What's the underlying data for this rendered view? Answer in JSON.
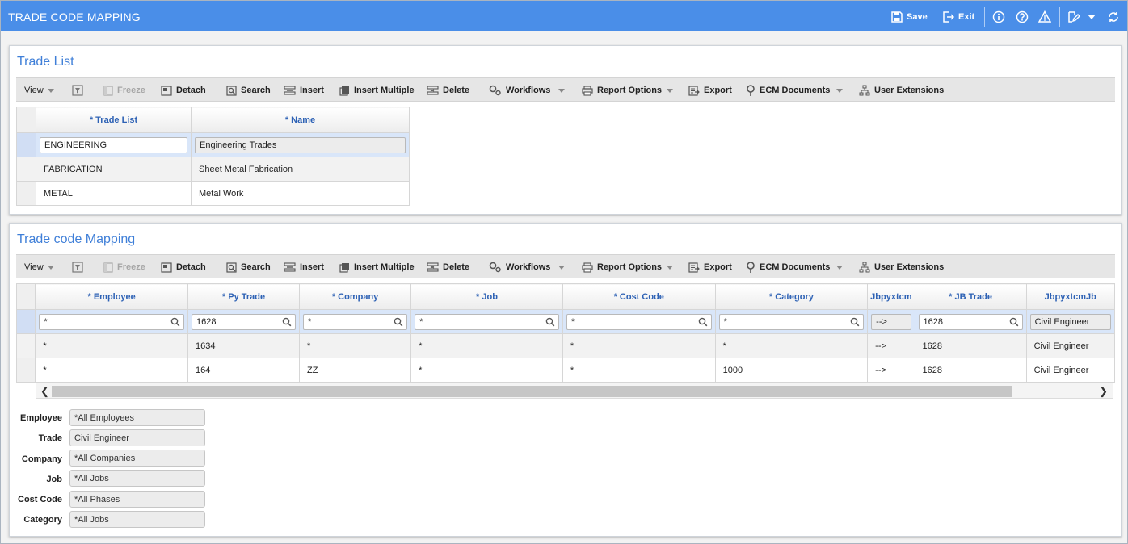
{
  "app": {
    "title": "TRADE CODE MAPPING",
    "save_label": "Save",
    "exit_label": "Exit"
  },
  "toolbar": {
    "view": "View",
    "freeze": "Freeze",
    "detach": "Detach",
    "search": "Search",
    "insert": "Insert",
    "insert_multiple": "Insert Multiple",
    "delete": "Delete",
    "workflows": "Workflows",
    "report_options": "Report Options",
    "export": "Export",
    "ecm_documents": "ECM Documents",
    "user_extensions": "User Extensions"
  },
  "trade_list": {
    "title": "Trade List",
    "columns": [
      "* Trade List",
      "* Name"
    ],
    "rows": [
      {
        "code": "ENGINEERING",
        "name": "Engineering Trades"
      },
      {
        "code": "FABRICATION",
        "name": "Sheet Metal Fabrication"
      },
      {
        "code": "METAL",
        "name": "Metal Work"
      }
    ]
  },
  "mapping": {
    "title": "Trade code Mapping",
    "columns": [
      "* Employee",
      "* Py Trade",
      "* Company",
      "* Job",
      "* Cost Code",
      "* Category",
      "Jbpyxtcm",
      "* JB Trade",
      "JbpyxtcmJb"
    ],
    "rows": [
      {
        "employee": "*",
        "py_trade": "1628",
        "company": "*",
        "job": "*",
        "cost_code": "*",
        "category": "*",
        "arrow": "-->",
        "jb_trade": "1628",
        "jb_name": "Civil Engineer"
      },
      {
        "employee": "*",
        "py_trade": "1634",
        "company": "*",
        "job": "*",
        "cost_code": "*",
        "category": "*",
        "arrow": "-->",
        "jb_trade": "1628",
        "jb_name": "Civil Engineer"
      },
      {
        "employee": "*",
        "py_trade": "164",
        "company": "ZZ",
        "job": "*",
        "cost_code": "*",
        "category": "1000",
        "arrow": "-->",
        "jb_trade": "1628",
        "jb_name": "Civil Engineer"
      }
    ]
  },
  "detail": {
    "fields": [
      {
        "label": "Employee",
        "value": "*All Employees"
      },
      {
        "label": "Trade",
        "value": "Civil Engineer"
      },
      {
        "label": "Company",
        "value": "*All Companies"
      },
      {
        "label": "Job",
        "value": "*All Jobs"
      },
      {
        "label": "Cost Code",
        "value": "*All Phases"
      },
      {
        "label": "Category",
        "value": "*All Jobs"
      }
    ]
  },
  "colors": {
    "titlebar": "#4a8ee8",
    "panel_title": "#3f7fd8",
    "column_header": "#2e62b5",
    "selected_row": "#d9e6f9"
  }
}
